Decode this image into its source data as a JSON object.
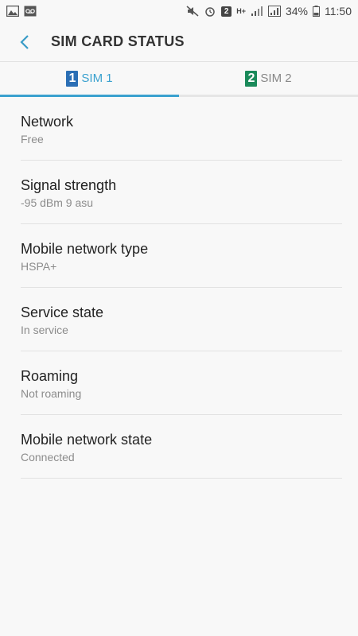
{
  "status_bar": {
    "battery_percent": "34%",
    "time": "11:50",
    "sim_badge": "2",
    "network_type": "H+"
  },
  "header": {
    "title": "SIM CARD STATUS"
  },
  "tabs": [
    {
      "number": "1",
      "label": "SIM 1",
      "color": "#2b6fb5",
      "active": true
    },
    {
      "number": "2",
      "label": "SIM 2",
      "color": "#1a8a5a",
      "active": false
    }
  ],
  "items": [
    {
      "title": "Network",
      "value": "Free"
    },
    {
      "title": "Signal strength",
      "value": "-95 dBm 9 asu"
    },
    {
      "title": "Mobile network type",
      "value": "HSPA+"
    },
    {
      "title": "Service state",
      "value": "In service"
    },
    {
      "title": "Roaming",
      "value": "Not roaming"
    },
    {
      "title": "Mobile network state",
      "value": "Connected"
    }
  ],
  "colors": {
    "accent": "#3aa1cf",
    "back_arrow": "#3a9cc7"
  }
}
